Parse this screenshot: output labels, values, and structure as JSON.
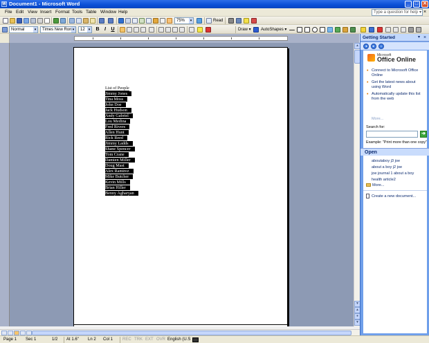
{
  "window": {
    "title": "Document1 - Microsoft Word",
    "app_icon_letter": "W",
    "min": "_",
    "max": "□",
    "close": "✕"
  },
  "menu": {
    "items": [
      "File",
      "Edit",
      "View",
      "Insert",
      "Format",
      "Tools",
      "Table",
      "Window",
      "Help"
    ],
    "help_placeholder": "Type a question for help",
    "help_arrow": "▾",
    "close_doc": "×"
  },
  "formatting": {
    "style": "Normal",
    "font": "Times New Roman",
    "size": "12",
    "bold": "B",
    "italic": "I",
    "underline": "U",
    "draw": "Draw ▾",
    "autoshapes": "AutoShapes ▾",
    "dropdown_arrow": "▾"
  },
  "standard": {
    "zoom": "75%",
    "read": "Read"
  },
  "document": {
    "lines": [
      "List of People",
      "Jimmy Jones",
      "Tina Moss",
      "John Doe",
      "Jack Hudson",
      "Andy Gabriel",
      "Lou Medina",
      "Fred Rivers",
      "Allen Hunt",
      "Rick Reed",
      "Jimmy Ladds",
      "Shane Spencer",
      "Tom Crane",
      "Damien Miller",
      "Doug Mast",
      "Alex Ramirez",
      "Mike Butcher",
      "Kevin Mills",
      "Brian Hiller",
      "Benny Agharyan"
    ]
  },
  "taskpane": {
    "title": "Getting Started",
    "dropdown": "▾",
    "close": "×",
    "nav_back": "◂",
    "nav_forward": "▸",
    "nav_home": "⌂",
    "logo_prefix": "Microsoft",
    "logo_text": "Office Online",
    "bullets": [
      "Connect to Microsoft Office Online",
      "Get the latest news about using Word",
      "Automatically update this list from the web"
    ],
    "more": "More...",
    "search_label": "Search for:",
    "search_go": "➔",
    "search_example": "Example: \"Print more than one copy\"",
    "open_heading": "Open",
    "files": [
      "aboutaboy j3 joe",
      "about a boy j2 joe",
      "joe journal 1 about a boy",
      "health article2"
    ],
    "more_files": "More...",
    "new_document": "Create a new document..."
  },
  "status": {
    "page": "Page 1",
    "sec": "Sec 1",
    "pages": "1/2",
    "at": "At 1.6\"",
    "ln": "Ln 2",
    "col": "Col 1",
    "rec": "REC",
    "trk": "TRK",
    "ext": "EXT",
    "ovr": "OVR",
    "lang": "English (U.S"
  },
  "scrollbar": {
    "up": "▲",
    "down": "▼",
    "prev_page": "▲",
    "select_browse": "●",
    "next_page": "▼"
  }
}
